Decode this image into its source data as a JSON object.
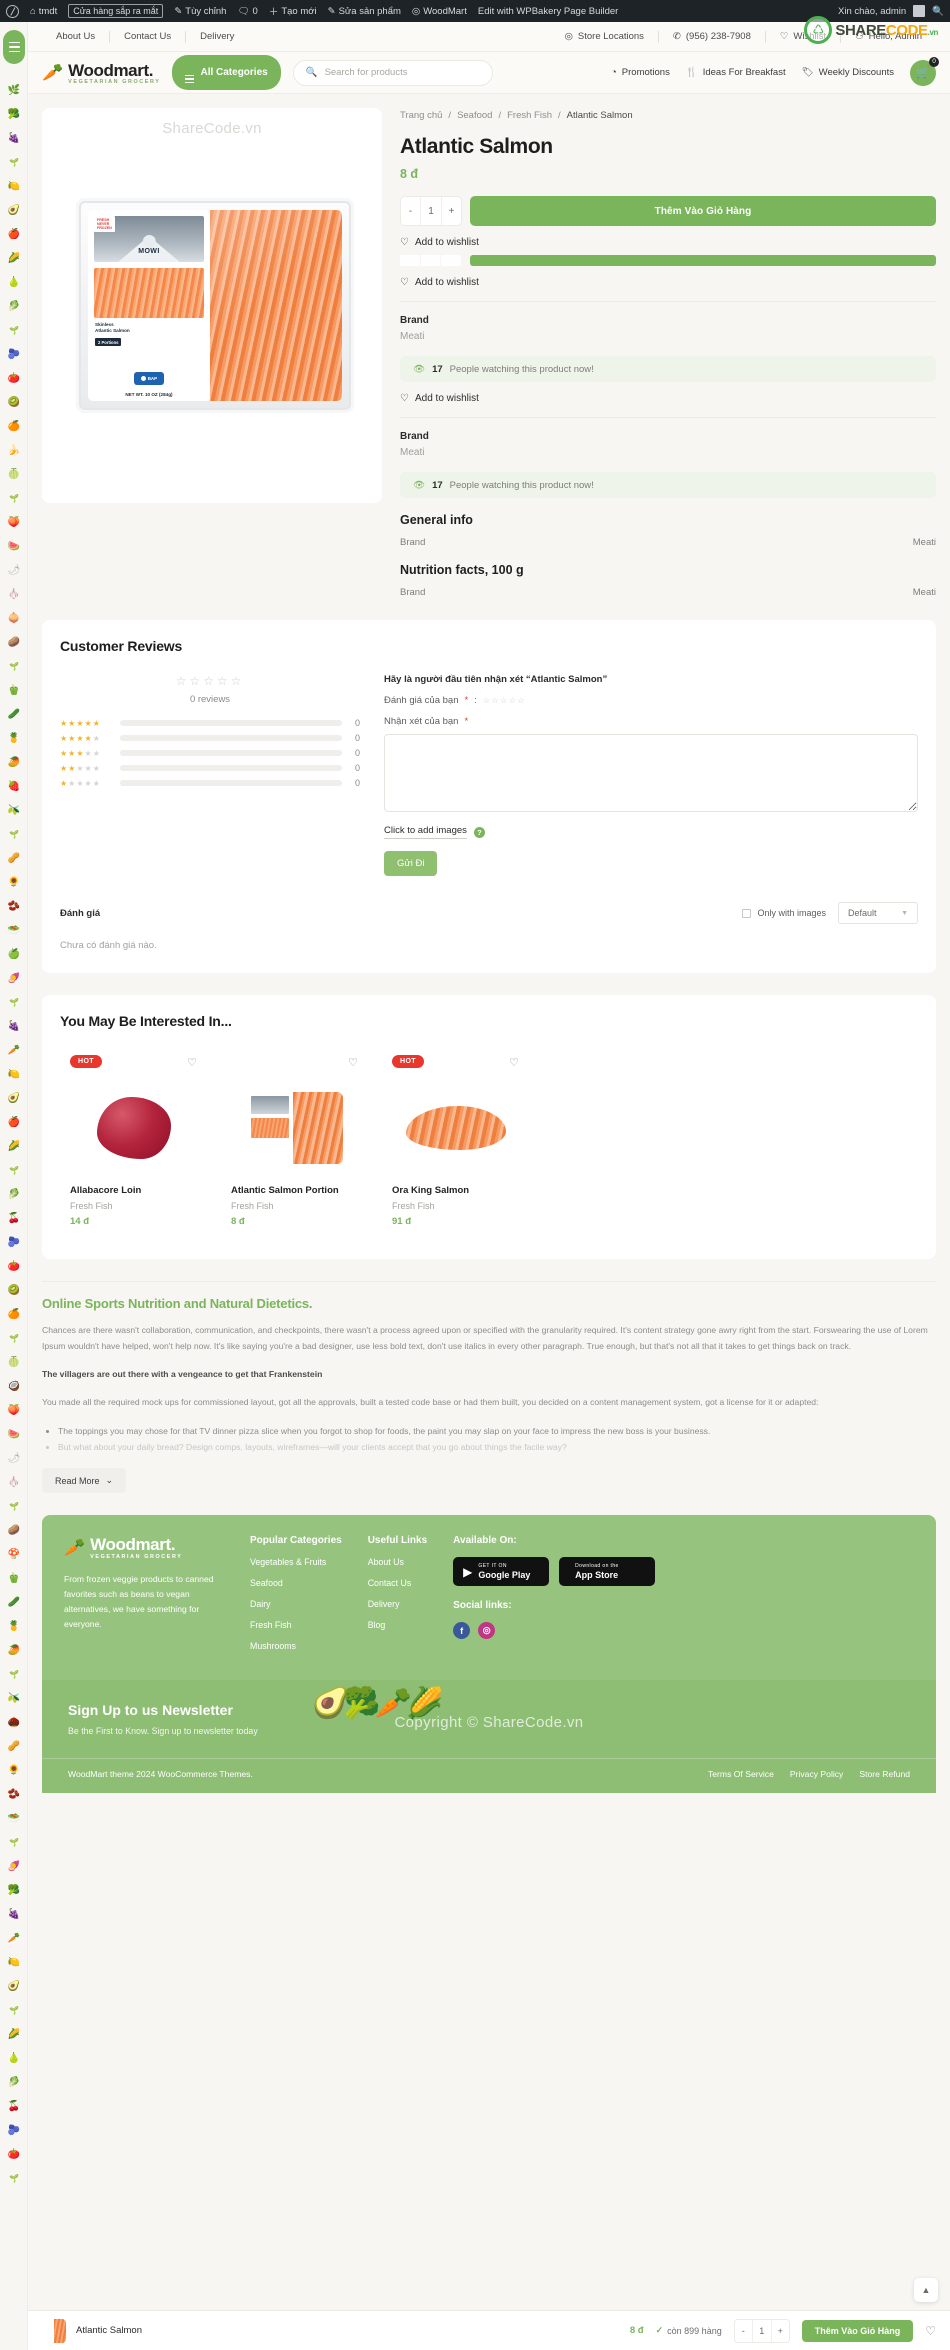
{
  "wpbar": {
    "site_name": "tmdt",
    "coming_soon": "Cửa hàng sắp ra mắt",
    "customize": "Tùy chỉnh",
    "comments_count": "0",
    "new": "Tạo mới",
    "edit_product": "Sửa sản phẩm",
    "woodmart": "WoodMart",
    "wpbakery": "Edit with WPBakery Page Builder",
    "greeting": "Xin chào, admin"
  },
  "watermark": {
    "gallery": "ShareCode.vn",
    "footer": "Copyright © ShareCode.vn",
    "logo_share": "SHARE",
    "logo_code": "CODE",
    "logo_vn": ".vn"
  },
  "topbar": {
    "links": [
      "About Us",
      "Contact Us",
      "Delivery"
    ],
    "store_locations": "Store Locations",
    "phone": "(956) 238-7908",
    "wishlist": "Wishlist",
    "account": "Hello, Admin"
  },
  "header": {
    "brand_name": "Woodmart.",
    "brand_sub": "VEGETARIAN GROCERY",
    "all_categories": "All Categories",
    "search_placeholder": "Search for products",
    "nav": [
      "Promotions",
      "Ideas For Breakfast",
      "Weekly Discounts"
    ],
    "cart_count": "0"
  },
  "product": {
    "breadcrumb": [
      "Trang chủ",
      "Seafood",
      "Fresh Fish",
      "Atlantic Salmon"
    ],
    "title": "Atlantic Salmon",
    "price": "8 đ",
    "price_currency": "đ",
    "qty": "1",
    "minus": "-",
    "plus": "+",
    "add_to_cart": "Thêm Vào Giỏ Hàng",
    "add_to_wishlist": "Add to wishlist",
    "brand_label": "Brand",
    "brand_value": "Meati",
    "watching_count": "17",
    "watching_text": "People watching this product now!",
    "general_info_title": "General info",
    "general_info_rows": [
      {
        "key": "Brand",
        "value": "Meati"
      }
    ],
    "nutrition_title": "Nutrition facts, 100 g",
    "nutrition_rows": [
      {
        "key": "Brand",
        "value": "Meati"
      }
    ]
  },
  "reviews": {
    "heading": "Customer Reviews",
    "summary_stars": "☆☆☆☆☆",
    "count_text": "0 reviews",
    "histogram": [
      {
        "stars": 5,
        "count": "0"
      },
      {
        "stars": 4,
        "count": "0"
      },
      {
        "stars": 3,
        "count": "0"
      },
      {
        "stars": 2,
        "count": "0"
      },
      {
        "stars": 1,
        "count": "0"
      }
    ],
    "form_title": "Hãy là người đầu tiên nhận xét “Atlantic Salmon”",
    "rating_label": "Đánh giá của bạn",
    "comment_label": "Nhận xét của bạn",
    "required_mark": "*",
    "add_images": "Click to add images",
    "help_mark": "?",
    "submit": "Gửi Đi",
    "list_title": "Đánh giá",
    "only_with_images": "Only with images",
    "sort_value": "Default",
    "empty_text": "Chưa có đánh giá nào."
  },
  "related": {
    "heading": "You May Be Interested In...",
    "badge_hot": "HOT",
    "items": [
      {
        "name": "Allabacore Loin",
        "category": "Fresh Fish",
        "price": "14 đ",
        "hot": true,
        "art": "tuna"
      },
      {
        "name": "Atlantic Salmon Portion",
        "category": "Fresh Fish",
        "price": "8 đ",
        "hot": false,
        "art": "pack"
      },
      {
        "name": "Ora King Salmon",
        "category": "Fresh Fish",
        "price": "91 đ",
        "hot": true,
        "art": "filet"
      }
    ]
  },
  "article": {
    "title": "Online Sports Nutrition and Natural Dietetics.",
    "p1": "Chances are there wasn't collaboration, communication, and checkpoints, there wasn't a process agreed upon or specified with the granularity required. It's content strategy gone awry right from the start. Forswearing the use of Lorem Ipsum wouldn't have helped, won't help now. It's like saying you're a bad designer, use less bold text, don't use italics in every other paragraph. True enough, but that's not all that it takes to get things back on track.",
    "p2": "The villagers are out there with a vengeance to get that Frankenstein",
    "p3": "You made all the required mock ups for commissioned layout, got all the approvals, built a tested code base or had them built, you decided on a content management system, got a license for it or adapted:",
    "bullet1": "The toppings you may chose for that TV dinner pizza slice when you forgot to shop for foods, the paint you may slap on your face to impress the new boss is your business.",
    "bullet2": "But what about your daily bread? Design comps, layouts, wireframes—will your clients accept that you go about things the facile way?",
    "read_more": "Read More"
  },
  "footer": {
    "brand_name": "Woodmart.",
    "brand_sub": "VEGETARIAN GROCERY",
    "brand_text": "From frozen veggie products to canned favorites such as beans to vegan alternatives, we have something for everyone.",
    "col1_title": "Popular Categories",
    "col1_items": [
      "Vegetables & Fruits",
      "Seafood",
      "Dairy",
      "Fresh Fish",
      "Mushrooms"
    ],
    "col2_title": "Useful Links",
    "col2_items": [
      "About Us",
      "Contact Us",
      "Delivery",
      "Blog"
    ],
    "col3_title": "Available On:",
    "google_play_top": "GET IT ON",
    "google_play_bottom": "Google Play",
    "app_store_top": "Download on the",
    "app_store_bottom": "App Store",
    "social_title": "Social links:",
    "newsletter_title": "Sign Up to us Newsletter",
    "newsletter_sub": "Be the First to Know. Sign up to newsletter today",
    "copyright": "WoodMart theme 2024 WooCommerce Themes.",
    "bottom_links": [
      "Terms Of Service",
      "Privacy Policy",
      "Store Refund"
    ]
  },
  "sticky": {
    "product_name": "Atlantic Salmon",
    "price": "8 đ",
    "stock": "còn 899 hàng",
    "tick": "✓",
    "qty": "1",
    "minus": "-",
    "plus": "+",
    "add_to_cart": "Thêm Vào Giỏ Hàng"
  },
  "colors": {
    "brand_green": "#7ab55c",
    "hot_red": "#e8372c",
    "star_gold": "#f0b429",
    "footer_green": "#96c47e"
  }
}
